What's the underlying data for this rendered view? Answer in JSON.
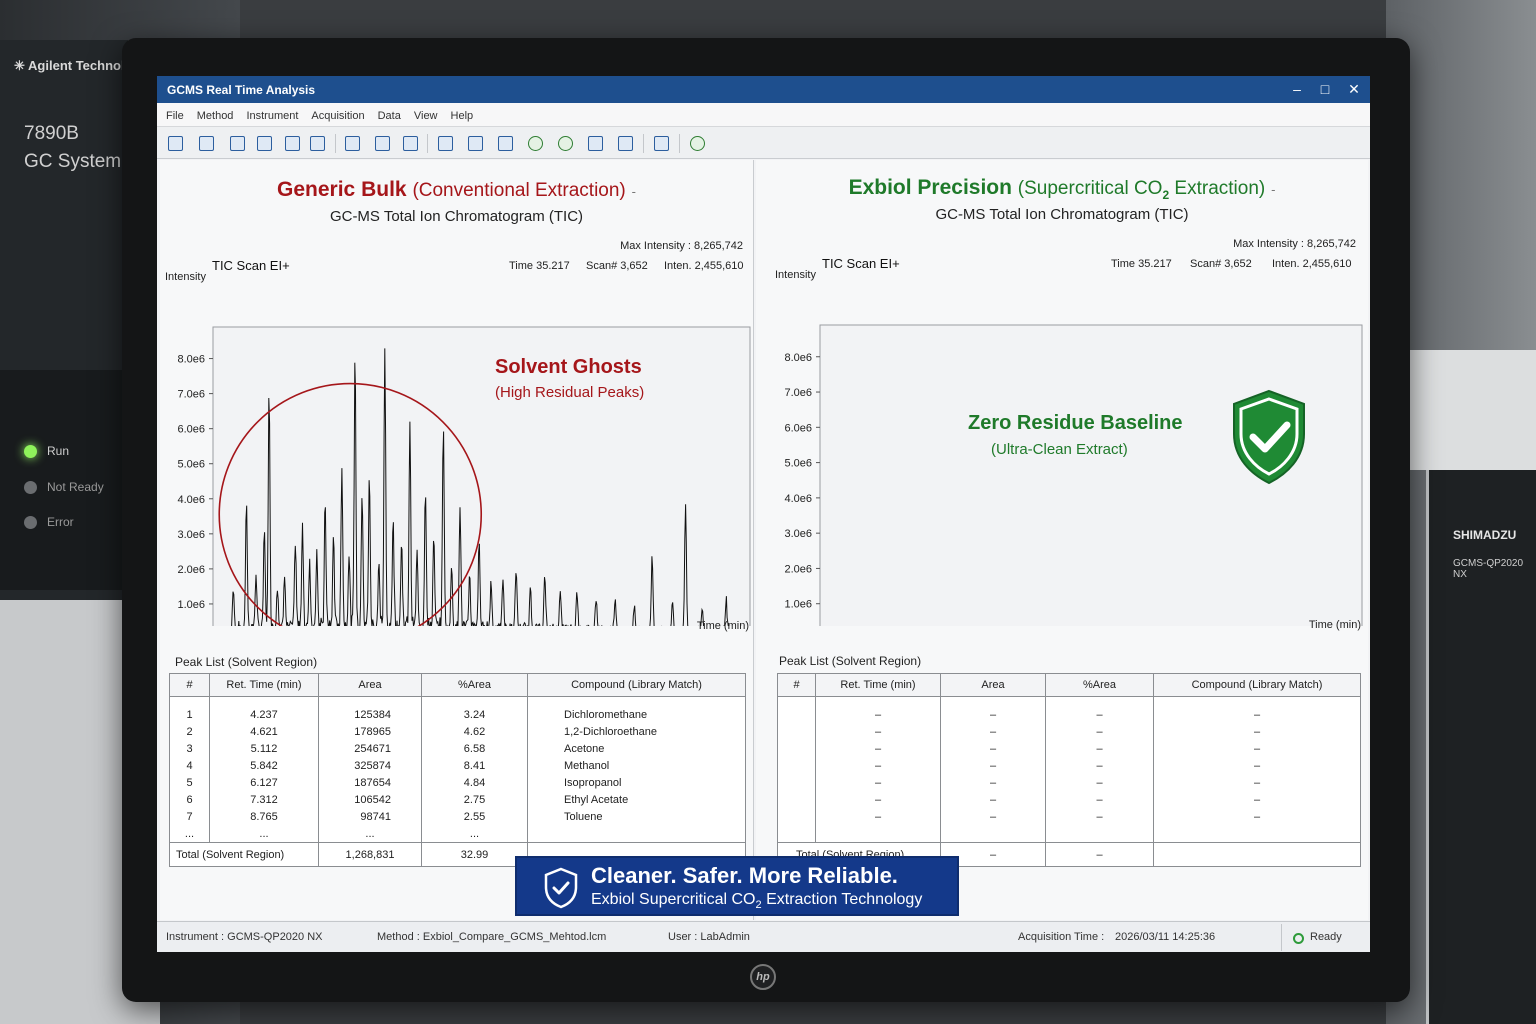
{
  "background": {
    "left_device": {
      "brand": "Agilent Technologies",
      "model": "7890B",
      "system": "GC System",
      "status": [
        {
          "label": "Run",
          "on": true
        },
        {
          "label": "Not Ready",
          "on": false
        },
        {
          "label": "Error",
          "on": false
        }
      ]
    },
    "right_device": {
      "brand": "SHIMADZU",
      "model": "GCMS-QP2020 NX"
    },
    "monitor_brand": "hp"
  },
  "window": {
    "title": "GCMS Real Time Analysis",
    "controls": {
      "minimize": "–",
      "maximize": "□",
      "close": "✕"
    },
    "menu": [
      "File",
      "Method",
      "Instrument",
      "Acquisition",
      "Data",
      "View",
      "Help"
    ]
  },
  "colors": {
    "generic_red": "#a5161a",
    "exbiol_green": "#1f7a2a",
    "banner_blue": "#14398a",
    "title_blue": "#1e4f8e"
  },
  "left_panel": {
    "title_main": "Generic Bulk",
    "title_sub": "(Conventional Extraction)",
    "title_suffix": "-",
    "subtitle": "GC-MS Total Ion Chromatogram (TIC)",
    "max_intensity": "Max Intensity : 8,265,742",
    "tic_label": "TIC Scan  EI+",
    "time_info": "Time  35.217",
    "scan_info": "Scan#  3,652",
    "inten_info": "Inten.  2,455,610",
    "y_axis_name": "Intensity",
    "x_axis_name": "Time (min)",
    "annotation_title": "Solvent Ghosts",
    "annotation_sub": "(High Residual Peaks)",
    "peak_list_title": "Peak List (Solvent Region)",
    "table_headers": [
      "#",
      "Ret. Time (min)",
      "Area",
      "%Area",
      "Compound (Library Match)"
    ],
    "rows": [
      [
        "1",
        "4.237",
        "125384",
        "3.24",
        "Dichloromethane"
      ],
      [
        "2",
        "4.621",
        "178965",
        "4.62",
        "1,2-Dichloroethane"
      ],
      [
        "3",
        "5.112",
        "254671",
        "6.58",
        "Acetone"
      ],
      [
        "4",
        "5.842",
        "325874",
        "8.41",
        "Methanol"
      ],
      [
        "5",
        "6.127",
        "187654",
        "4.84",
        "Isopropanol"
      ],
      [
        "6",
        "7.312",
        "106542",
        "2.75",
        "Ethyl Acetate"
      ],
      [
        "7",
        "8.765",
        "98741",
        "2.55",
        "Toluene"
      ],
      [
        "...",
        "...",
        "...",
        "...",
        ""
      ]
    ],
    "total": [
      "Total (Solvent Region)",
      "1,268,831",
      "32.99",
      ""
    ]
  },
  "right_panel": {
    "title_main": "Exbiol Precision",
    "title_sub_pre": "(Supercritical CO",
    "title_sub_sub": "2",
    "title_sub_post": " Extraction)",
    "title_suffix": "-",
    "subtitle": "GC-MS Total Ion Chromatogram (TIC)",
    "max_intensity": "Max Intensity : 8,265,742",
    "tic_label": "TIC Scan  EI+",
    "time_info": "Time  35.217",
    "scan_info": "Scan#  3,652",
    "inten_info": "Inten.  2,455,610",
    "y_axis_name": "Intensity",
    "x_axis_name": "Time (min)",
    "annotation_title": "Zero Residue Baseline",
    "annotation_sub": "(Ultra-Clean Extract)",
    "badge_icon": "shield-check-icon",
    "peak_list_title": "Peak List (Solvent Region)",
    "table_headers": [
      "#",
      "Ret. Time (min)",
      "Area",
      "%Area",
      "Compound (Library Match)"
    ],
    "rows": [
      [
        "",
        "–",
        "–",
        "–",
        "–"
      ],
      [
        "",
        "–",
        "–",
        "–",
        "–"
      ],
      [
        "",
        "–",
        "–",
        "–",
        "–"
      ],
      [
        "",
        "–",
        "–",
        "–",
        "–"
      ],
      [
        "",
        "–",
        "–",
        "–",
        "–"
      ],
      [
        "",
        "–",
        "–",
        "–",
        "–"
      ],
      [
        "",
        "–",
        "–",
        "–",
        "–"
      ],
      [
        "",
        "",
        "",
        "",
        ""
      ]
    ],
    "total": [
      "Total (Solvent Region)",
      "–",
      "–",
      ""
    ]
  },
  "banner": {
    "line1": "Cleaner. Safer. More Reliable.",
    "line2_pre": "Exbiol Supercritical CO",
    "line2_sub": "2",
    "line2_post": " Extraction Technology"
  },
  "statusbar": {
    "instrument": "Instrument :  GCMS-QP2020 NX",
    "method": "Method :  Exbiol_Compare_GCMS_Mehtod.lcm",
    "user": "User :  LabAdmin",
    "acq_label": "Acquisition Time :",
    "acq_time": "2026/03/11  14:25:36",
    "status": "Ready"
  },
  "chart_data": [
    {
      "type": "line",
      "title": "Generic Bulk (Conventional Extraction)",
      "subtitle": "GC-MS Total Ion Chromatogram (TIC)",
      "xlabel": "Time (min)",
      "ylabel": "Intensity",
      "xlim": [
        0.5,
        45.5
      ],
      "ylim": [
        0,
        8900000.0
      ],
      "yticks": [
        "0.0e0",
        "1.0e6",
        "2.0e6",
        "3.0e6",
        "4.0e6",
        "5.0e6",
        "6.0e6",
        "7.0e6",
        "8.0e6"
      ],
      "xticks": [
        "2.5",
        "5.0",
        "7.5",
        "10.0",
        "12.5",
        "15.0",
        "17.5",
        "20.0",
        "22.5",
        "25.0",
        "27.5",
        "30.0",
        "32.5",
        "35.0",
        "37.5",
        "40.0",
        "42.5",
        "45.0"
      ],
      "baseline": 250000,
      "peaks": [
        [
          2.2,
          1100000.0
        ],
        [
          3.3,
          3600000.0
        ],
        [
          4.1,
          1500000.0
        ],
        [
          4.8,
          2800000.0
        ],
        [
          5.2,
          6700000.0
        ],
        [
          5.9,
          1200000.0
        ],
        [
          6.5,
          1600000.0
        ],
        [
          7.4,
          2400000.0
        ],
        [
          8.0,
          3000000.0
        ],
        [
          8.6,
          1800000.0
        ],
        [
          9.2,
          2200000.0
        ],
        [
          9.9,
          3600000.0
        ],
        [
          10.6,
          2600000.0
        ],
        [
          11.3,
          4600000.0
        ],
        [
          11.9,
          2100000.0
        ],
        [
          12.4,
          7900000.0
        ],
        [
          13.0,
          3900000.0
        ],
        [
          13.6,
          4300000.0
        ],
        [
          14.4,
          1800000.0
        ],
        [
          14.9,
          7800000.0
        ],
        [
          15.6,
          3100000.0
        ],
        [
          16.3,
          2400000.0
        ],
        [
          17.0,
          5900000.0
        ],
        [
          17.6,
          2000000.0
        ],
        [
          18.3,
          4000000.0
        ],
        [
          19.0,
          2500000.0
        ],
        [
          19.8,
          5800000.0
        ],
        [
          20.5,
          1700000.0
        ],
        [
          21.2,
          3500000.0
        ],
        [
          22.0,
          1500000.0
        ],
        [
          22.8,
          2400000.0
        ],
        [
          23.8,
          1300000.0
        ],
        [
          24.8,
          1400000.0
        ],
        [
          25.9,
          1700000.0
        ],
        [
          27.1,
          1200000.0
        ],
        [
          28.3,
          1500000.0
        ],
        [
          29.6,
          1000000.0
        ],
        [
          31.0,
          1100000.0
        ],
        [
          32.6,
          900000.0
        ],
        [
          34.2,
          800000.0
        ],
        [
          35.8,
          700000.0
        ],
        [
          37.3,
          2200000.0
        ],
        [
          39.0,
          800000.0
        ],
        [
          40.1,
          3600000.0
        ],
        [
          41.5,
          600000.0
        ],
        [
          43.5,
          900000.0
        ]
      ]
    },
    {
      "type": "line",
      "title": "Exbiol Precision (Supercritical CO2 Extraction)",
      "subtitle": "GC-MS Total Ion Chromatogram (TIC)",
      "xlabel": "Time (min)",
      "ylabel": "Intensity",
      "xlim": [
        0.5,
        45.5
      ],
      "ylim": [
        0,
        8900000.0
      ],
      "yticks": [
        "0.0e0",
        "1.0e6",
        "2.0e6",
        "3.0e6",
        "4.0e6",
        "5.0e6",
        "6.0e6",
        "7.0e6",
        "8.0e6"
      ],
      "xticks": [
        "2.5",
        "5.0",
        "7.5",
        "10.0",
        "12.5",
        "15.0",
        "17.5",
        "20.0",
        "22.5",
        "25.0",
        "27.5",
        "30.0",
        "32.5",
        "35.0",
        "37.5",
        "40.0",
        "42.5",
        "45.0"
      ],
      "baseline": 60000,
      "peaks": []
    }
  ]
}
